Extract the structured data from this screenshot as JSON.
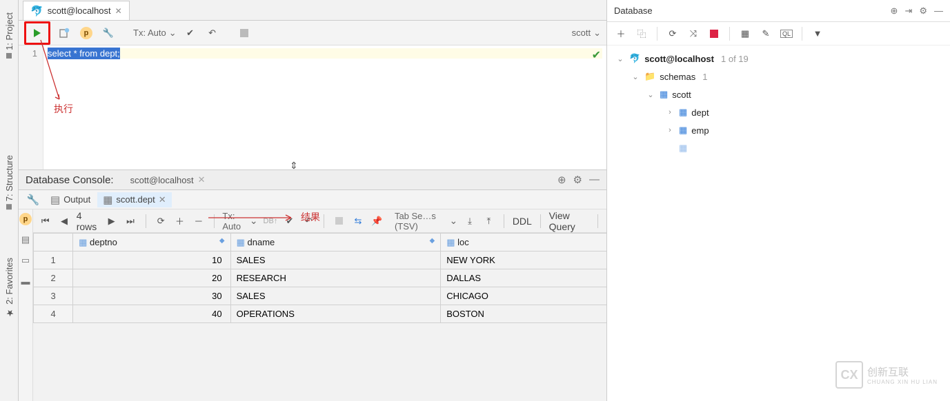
{
  "left_strip": {
    "project": "1: Project",
    "structure": "7: Structure",
    "favorites": "2: Favorites"
  },
  "editor_tab": {
    "title": "scott@localhost"
  },
  "toolbar": {
    "tx": "Tx: Auto",
    "schema": "scott"
  },
  "code": {
    "line_no": "1",
    "sql_sel": "select * from dept",
    "sql_tail": ";"
  },
  "annotations": {
    "exec": "执行",
    "result": "结果"
  },
  "console": {
    "title": "Database Console:",
    "tab": "scott@localhost"
  },
  "result_tabs": {
    "output": "Output",
    "scott_dept": "scott.dept"
  },
  "grid_toolbar": {
    "rows": "4 rows",
    "tx": "Tx: Auto",
    "tab_format": "Tab Se…s (TSV)",
    "ddl": "DDL",
    "view_query": "View Query"
  },
  "table": {
    "columns": [
      "deptno",
      "dname",
      "loc"
    ],
    "rows": [
      {
        "n": "1",
        "deptno": "10",
        "dname": "SALES",
        "loc": "NEW YORK"
      },
      {
        "n": "2",
        "deptno": "20",
        "dname": "RESEARCH",
        "loc": "DALLAS"
      },
      {
        "n": "3",
        "deptno": "30",
        "dname": "SALES",
        "loc": "CHICAGO"
      },
      {
        "n": "4",
        "deptno": "40",
        "dname": "OPERATIONS",
        "loc": "BOSTON"
      }
    ]
  },
  "db_panel": {
    "title": "Database",
    "conn": "scott@localhost",
    "conn_meta": "1 of 19",
    "schemas": "schemas",
    "schemas_count": "1",
    "schema": "scott",
    "tables": [
      "dept",
      "emp"
    ]
  },
  "watermark": {
    "brand": "创新互联",
    "sub": "CHUANG XIN HU LIAN"
  }
}
